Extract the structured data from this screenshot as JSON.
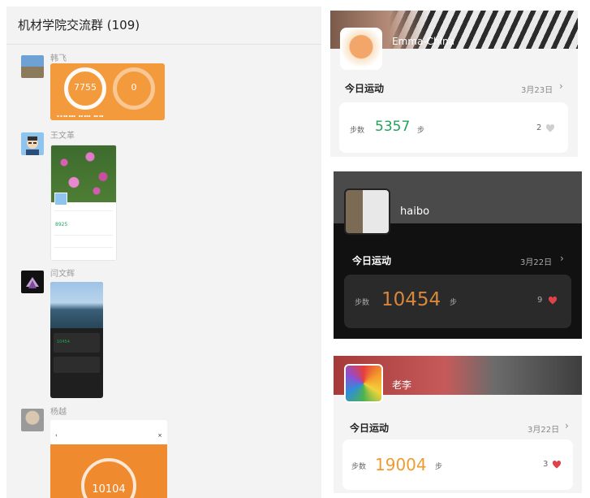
{
  "chat": {
    "title": "机材学院交流群 (109)",
    "messages": [
      {
        "sender": "韩飞",
        "steps": "7755",
        "second_ring": "0"
      },
      {
        "sender": "王文革",
        "steps": "8925"
      },
      {
        "sender": "闫文辉",
        "steps": "10454"
      },
      {
        "sender": "杨越",
        "steps": "10104"
      }
    ]
  },
  "cards": [
    {
      "name": "Emma-China",
      "today_label": "今日运动",
      "date": "3月23日",
      "steps_label": "步数",
      "steps": "5357",
      "unit": "步",
      "likes": "2",
      "value_color": "#21a359",
      "liked": false
    },
    {
      "name": "haibo",
      "today_label": "今日运动",
      "date": "3月22日",
      "steps_label": "步数",
      "steps": "10454",
      "unit": "步",
      "likes": "9",
      "value_color": "#d9873a",
      "liked": true
    },
    {
      "name": "老李",
      "today_label": "今日运动",
      "date": "3月22日",
      "steps_label": "步数",
      "steps": "19004",
      "unit": "步",
      "likes": "3",
      "value_color": "#f09b32",
      "liked": true
    }
  ],
  "icons": {
    "chevron": "chevron-right-icon",
    "heart": "heart-icon"
  }
}
